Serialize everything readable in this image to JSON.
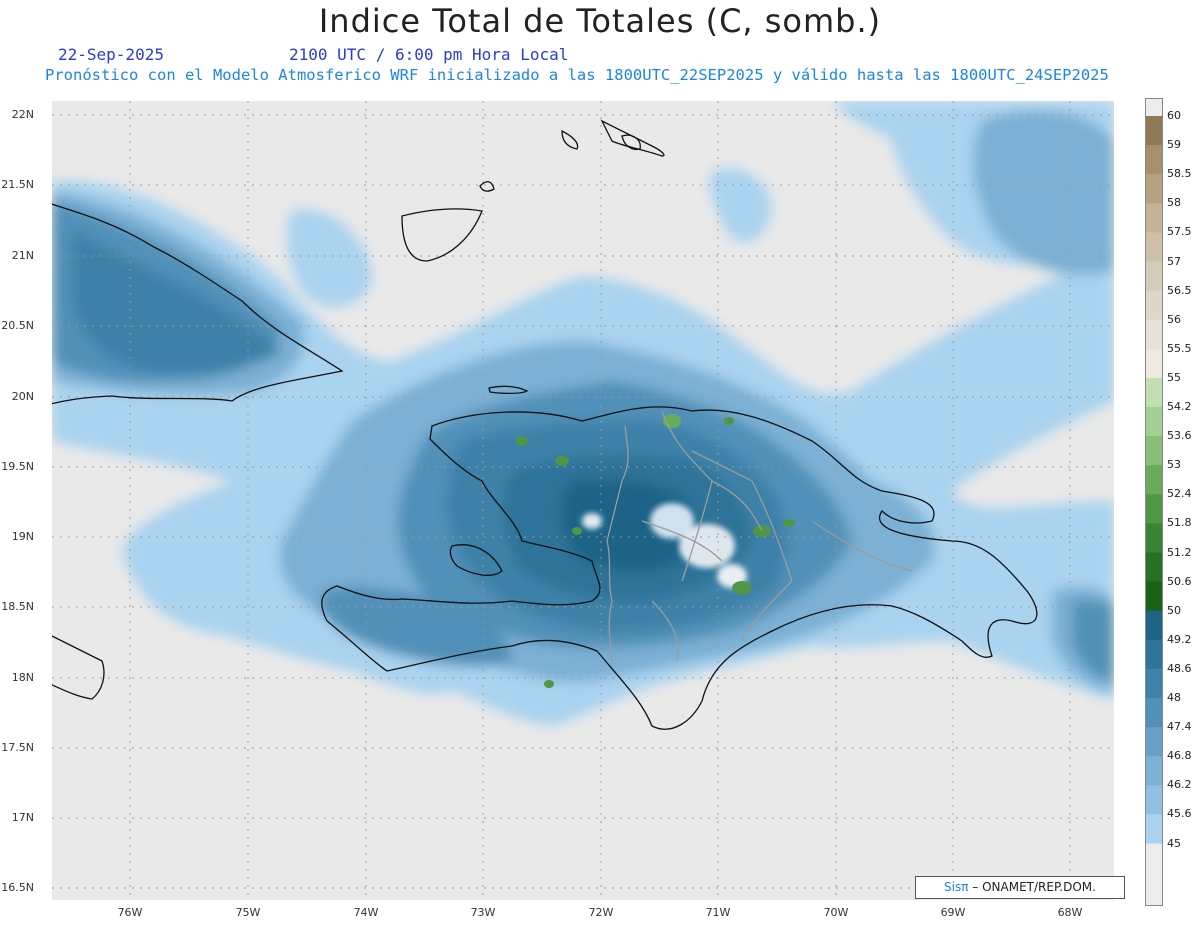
{
  "header": {
    "title": "Indice Total de Totales (C, somb.)",
    "date": "22-Sep-2025",
    "time": "2100 UTC / 6:00 pm Hora Local",
    "forecast": "Pronóstico con el Modelo Atmosferico WRF inicializado a las 1800UTC_22SEP2025 y válido hasta las  1800UTC_24SEP2025"
  },
  "map": {
    "lat_labels": [
      "22N",
      "21.5N",
      "21N",
      "20.5N",
      "20N",
      "19.5N",
      "19N",
      "18.5N",
      "18N",
      "17.5N",
      "17N",
      "16.5N"
    ],
    "lon_labels": [
      "76W",
      "75W",
      "74W",
      "73W",
      "72W",
      "71W",
      "70W",
      "69W",
      "68W"
    ],
    "background_color": "#e9e9e9"
  },
  "colorbar": {
    "labels": [
      "60",
      "59",
      "58.5",
      "58",
      "57.5",
      "57",
      "56.5",
      "56",
      "55.5",
      "55",
      "54.2",
      "53.6",
      "53",
      "52.4",
      "51.8",
      "51.2",
      "50.6",
      "50",
      "49.2",
      "48.6",
      "48",
      "47.4",
      "46.8",
      "46.2",
      "45.6",
      "45"
    ],
    "colors": [
      "#8e7a56",
      "#a5906a",
      "#b4a283",
      "#c2b396",
      "#cdc0a8",
      "#d6cbb8",
      "#dfd6c8",
      "#e7e1d6",
      "#eeeae2",
      "#c1dfb3",
      "#a4cf94",
      "#86bd77",
      "#69aa5b",
      "#4f9745",
      "#398433",
      "#267125",
      "#1a6219",
      "#1e6487",
      "#2e7399",
      "#3e81a9",
      "#5190b8",
      "#66a0c6",
      "#7cb0d4",
      "#91c1e1",
      "#a9d3ef"
    ]
  },
  "credit": {
    "brand": "Sisπ",
    "text": "– ONAMET/REP.DOM."
  }
}
